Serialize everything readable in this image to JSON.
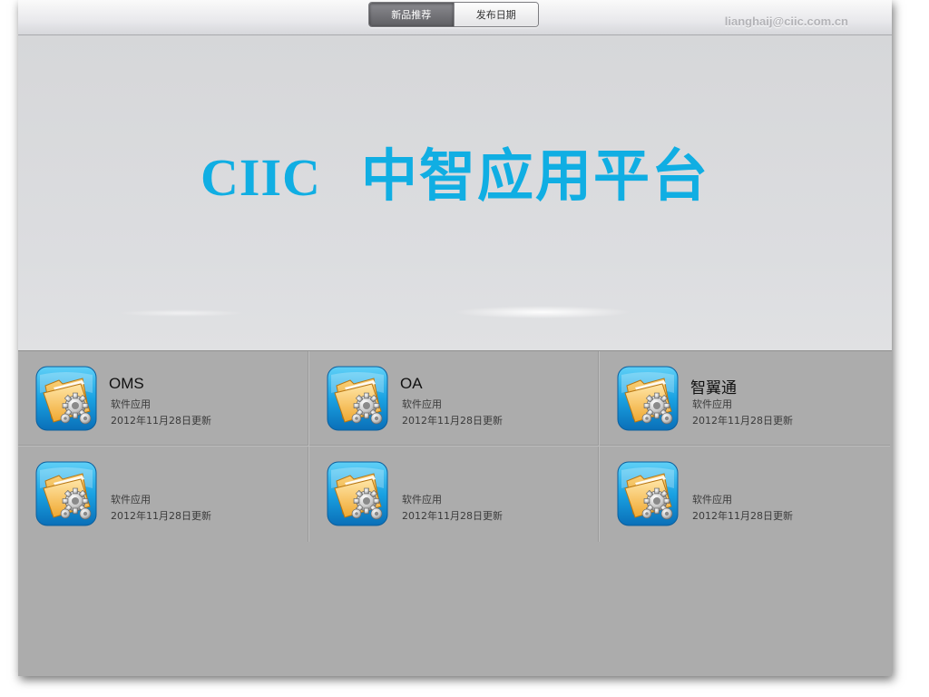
{
  "header": {
    "tabs": [
      {
        "label": "新品推荐",
        "active": true
      },
      {
        "label": "发布日期",
        "active": false
      }
    ],
    "user_email": "lianghaij@ciic.com.cn"
  },
  "hero": {
    "brand": "CIIC",
    "title": "中智应用平台"
  },
  "apps": [
    {
      "name": "OMS",
      "category": "软件应用",
      "updated": "2012年11月28日更新",
      "icon": "folder-gear-icon"
    },
    {
      "name": "OA",
      "category": "软件应用",
      "updated": "2012年11月28日更新",
      "icon": "folder-gear-icon"
    },
    {
      "name": "智翼通",
      "category": "软件应用",
      "updated": "2012年11月28日更新",
      "icon": "folder-gear-icon"
    },
    {
      "name": "",
      "category": "软件应用",
      "updated": "2012年11月28日更新",
      "icon": "folder-gear-icon"
    },
    {
      "name": "",
      "category": "软件应用",
      "updated": "2012年11月28日更新",
      "icon": "folder-gear-icon"
    },
    {
      "name": "",
      "category": "软件应用",
      "updated": "2012年11月28日更新",
      "icon": "folder-gear-icon"
    }
  ],
  "colors": {
    "accent": "#10aee3",
    "icon_tile": "#1a9fe0",
    "folder": "#f6b63c",
    "background": "#acacac"
  }
}
